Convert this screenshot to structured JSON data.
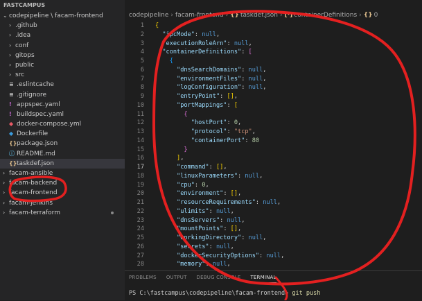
{
  "colors": {
    "annotation": "#e32020",
    "accent": "#007acc"
  },
  "explorer": {
    "section_title": "FASTCAMPUS",
    "items": [
      {
        "label": "codepipeline \\ facam-frontend",
        "kind": "folder-open",
        "icon": "chevron-down-icon"
      },
      {
        "label": ".github",
        "kind": "folder",
        "icon": "chevron-right-icon"
      },
      {
        "label": ".idea",
        "kind": "folder",
        "icon": "chevron-right-icon"
      },
      {
        "label": "conf",
        "kind": "folder",
        "icon": "chevron-right-icon"
      },
      {
        "label": "gitops",
        "kind": "folder",
        "icon": "chevron-right-icon"
      },
      {
        "label": "public",
        "kind": "folder",
        "icon": "chevron-right-icon"
      },
      {
        "label": "src",
        "kind": "folder",
        "icon": "chevron-right-icon"
      },
      {
        "label": ".eslintcache",
        "kind": "file",
        "icon": "lines-file-icon",
        "glyph": "≡",
        "color": "#c5c5c5"
      },
      {
        "label": ".gitignore",
        "kind": "file",
        "icon": "lines-file-icon",
        "glyph": "≡",
        "color": "#c5c5c5"
      },
      {
        "label": "appspec.yaml",
        "kind": "file",
        "icon": "yaml-file-icon",
        "glyph": "!",
        "color": "#cb6ad7"
      },
      {
        "label": "buildspec.yaml",
        "kind": "file",
        "icon": "yaml-file-icon",
        "glyph": "!",
        "color": "#cb6ad7"
      },
      {
        "label": "docker-compose.yml",
        "kind": "file",
        "icon": "docker-compose-icon",
        "glyph": "◆",
        "color": "#e95a66"
      },
      {
        "label": "Dockerfile",
        "kind": "file",
        "icon": "docker-icon",
        "glyph": "◆",
        "color": "#3a9bdc"
      },
      {
        "label": "package.json",
        "kind": "file",
        "icon": "json-file-icon",
        "glyph": "{}",
        "color": "#e2c08d"
      },
      {
        "label": "README.md",
        "kind": "file",
        "icon": "info-icon",
        "glyph": "ⓘ",
        "color": "#519aba"
      },
      {
        "label": "taskdef.json",
        "kind": "file",
        "icon": "json-file-icon",
        "glyph": "{}",
        "color": "#e2c08d",
        "selected": true
      },
      {
        "label": "facam-ansible",
        "kind": "folder-root",
        "icon": "chevron-right-icon"
      },
      {
        "label": "facam-backend",
        "kind": "folder-root",
        "icon": "chevron-right-icon"
      },
      {
        "label": "facam-frontend",
        "kind": "folder-root",
        "icon": "chevron-right-icon"
      },
      {
        "label": "facam-jenkins",
        "kind": "folder-root",
        "icon": "chevron-right-icon"
      },
      {
        "label": "facam-terraform",
        "kind": "folder-root",
        "icon": "chevron-right-icon",
        "dot": true
      }
    ]
  },
  "breadcrumb": {
    "parts": [
      "codepipeline",
      "facam-frontend",
      "taskdef.json",
      "containerDefinitions",
      "0"
    ],
    "icons": [
      "",
      "",
      "{}",
      "[·]",
      "{}"
    ]
  },
  "editor": {
    "active_line": 17,
    "lines": [
      {
        "n": "1",
        "t": [
          [
            "b1",
            "{"
          ]
        ]
      },
      {
        "n": "2",
        "t": [
          [
            "k",
            "  \"ipcMode\""
          ],
          [
            "p",
            ": "
          ],
          [
            "lit",
            "null"
          ],
          [
            "p",
            ","
          ]
        ]
      },
      {
        "n": "3",
        "t": [
          [
            "k",
            "  \"executionRoleArn\""
          ],
          [
            "p",
            ": "
          ],
          [
            "lit",
            "null"
          ],
          [
            "p",
            ","
          ]
        ]
      },
      {
        "n": "4",
        "t": [
          [
            "k",
            "  \"containerDefinitions\""
          ],
          [
            "p",
            ": "
          ],
          [
            "b2",
            "["
          ]
        ]
      },
      {
        "n": "5",
        "t": [
          [
            "b3",
            "    {"
          ]
        ]
      },
      {
        "n": "6",
        "t": [
          [
            "k",
            "      \"dnsSearchDomains\""
          ],
          [
            "p",
            ": "
          ],
          [
            "lit",
            "null"
          ],
          [
            "p",
            ","
          ]
        ]
      },
      {
        "n": "7",
        "t": [
          [
            "k",
            "      \"environmentFiles\""
          ],
          [
            "p",
            ": "
          ],
          [
            "lit",
            "null"
          ],
          [
            "p",
            ","
          ]
        ]
      },
      {
        "n": "8",
        "t": [
          [
            "k",
            "      \"logConfiguration\""
          ],
          [
            "p",
            ": "
          ],
          [
            "lit",
            "null"
          ],
          [
            "p",
            ","
          ]
        ]
      },
      {
        "n": "9",
        "t": [
          [
            "k",
            "      \"entryPoint\""
          ],
          [
            "p",
            ": "
          ],
          [
            "b1",
            "[]"
          ],
          [
            "p",
            ","
          ]
        ]
      },
      {
        "n": "10",
        "t": [
          [
            "k",
            "      \"portMappings\""
          ],
          [
            "p",
            ": "
          ],
          [
            "b1",
            "["
          ]
        ]
      },
      {
        "n": "11",
        "t": [
          [
            "b2",
            "        {"
          ]
        ]
      },
      {
        "n": "12",
        "t": [
          [
            "k",
            "          \"hostPort\""
          ],
          [
            "p",
            ": "
          ],
          [
            "n",
            "0"
          ],
          [
            "p",
            ","
          ]
        ]
      },
      {
        "n": "13",
        "t": [
          [
            "k",
            "          \"protocol\""
          ],
          [
            "p",
            ": "
          ],
          [
            "s",
            "\"tcp\""
          ],
          [
            "p",
            ","
          ]
        ]
      },
      {
        "n": "14",
        "t": [
          [
            "k",
            "          \"containerPort\""
          ],
          [
            "p",
            ": "
          ],
          [
            "n",
            "80"
          ]
        ]
      },
      {
        "n": "15",
        "t": [
          [
            "b2",
            "        }"
          ]
        ]
      },
      {
        "n": "16",
        "t": [
          [
            "b1",
            "      ]"
          ],
          [
            "p",
            ","
          ]
        ]
      },
      {
        "n": "17",
        "t": [
          [
            "k",
            "      \"command\""
          ],
          [
            "p",
            ": "
          ],
          [
            "b1",
            "[]"
          ],
          [
            "p",
            ","
          ]
        ]
      },
      {
        "n": "18",
        "t": [
          [
            "k",
            "      \"linuxParameters\""
          ],
          [
            "p",
            ": "
          ],
          [
            "lit",
            "null"
          ],
          [
            "p",
            ","
          ]
        ]
      },
      {
        "n": "19",
        "t": [
          [
            "k",
            "      \"cpu\""
          ],
          [
            "p",
            ": "
          ],
          [
            "n",
            "0"
          ],
          [
            "p",
            ","
          ]
        ]
      },
      {
        "n": "20",
        "t": [
          [
            "k",
            "      \"environment\""
          ],
          [
            "p",
            ": "
          ],
          [
            "b1",
            "[]"
          ],
          [
            "p",
            ","
          ]
        ]
      },
      {
        "n": "21",
        "t": [
          [
            "k",
            "      \"resourceRequirements\""
          ],
          [
            "p",
            ": "
          ],
          [
            "lit",
            "null"
          ],
          [
            "p",
            ","
          ]
        ]
      },
      {
        "n": "22",
        "t": [
          [
            "k",
            "      \"ulimits\""
          ],
          [
            "p",
            ": "
          ],
          [
            "lit",
            "null"
          ],
          [
            "p",
            ","
          ]
        ]
      },
      {
        "n": "23",
        "t": [
          [
            "k",
            "      \"dnsServers\""
          ],
          [
            "p",
            ": "
          ],
          [
            "lit",
            "null"
          ],
          [
            "p",
            ","
          ]
        ]
      },
      {
        "n": "24",
        "t": [
          [
            "k",
            "      \"mountPoints\""
          ],
          [
            "p",
            ": "
          ],
          [
            "b1",
            "[]"
          ],
          [
            "p",
            ","
          ]
        ]
      },
      {
        "n": "25",
        "t": [
          [
            "k",
            "      \"workingDirectory\""
          ],
          [
            "p",
            ": "
          ],
          [
            "lit",
            "null"
          ],
          [
            "p",
            ","
          ]
        ]
      },
      {
        "n": "26",
        "t": [
          [
            "k",
            "      \"secrets\""
          ],
          [
            "p",
            ": "
          ],
          [
            "lit",
            "null"
          ],
          [
            "p",
            ","
          ]
        ]
      },
      {
        "n": "27",
        "t": [
          [
            "k",
            "      \"dockerSecurityOptions\""
          ],
          [
            "p",
            ": "
          ],
          [
            "lit",
            "null"
          ],
          [
            "p",
            ","
          ]
        ]
      },
      {
        "n": "28",
        "t": [
          [
            "k",
            "      \"memory\""
          ],
          [
            "p",
            ": "
          ],
          [
            "lit",
            "null"
          ],
          [
            "p",
            ","
          ]
        ]
      }
    ]
  },
  "panel": {
    "tabs": [
      "PROBLEMS",
      "OUTPUT",
      "DEBUG CONSOLE",
      "TERMINAL"
    ],
    "active_tab": 3,
    "prompt": "PS C:\\fastcampus\\codepipeline\\facam-frontend>",
    "command": "git push"
  }
}
